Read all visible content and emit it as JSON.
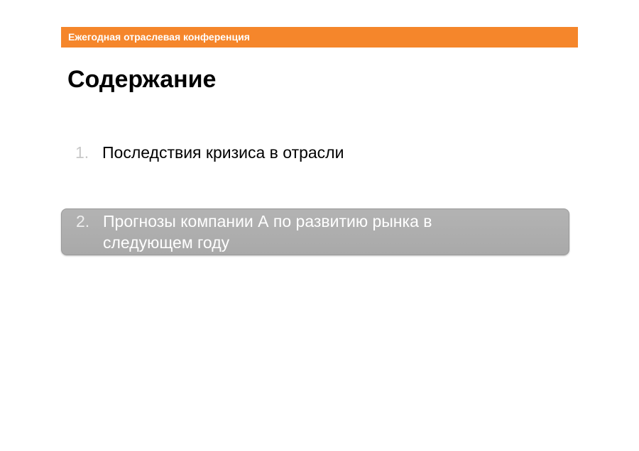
{
  "header": {
    "banner_text": "Ежегодная отраслевая конференция",
    "accent_color": "#f5862b"
  },
  "slide": {
    "title": "Содержание"
  },
  "agenda": {
    "items": [
      {
        "number": "1.",
        "label": "Последствия кризиса в отрасли",
        "highlighted": false
      },
      {
        "number": "2.",
        "label": "Прогнозы компании А по развитию рынка в следующем году",
        "highlighted": true
      }
    ],
    "highlight_color": "#acacac"
  }
}
